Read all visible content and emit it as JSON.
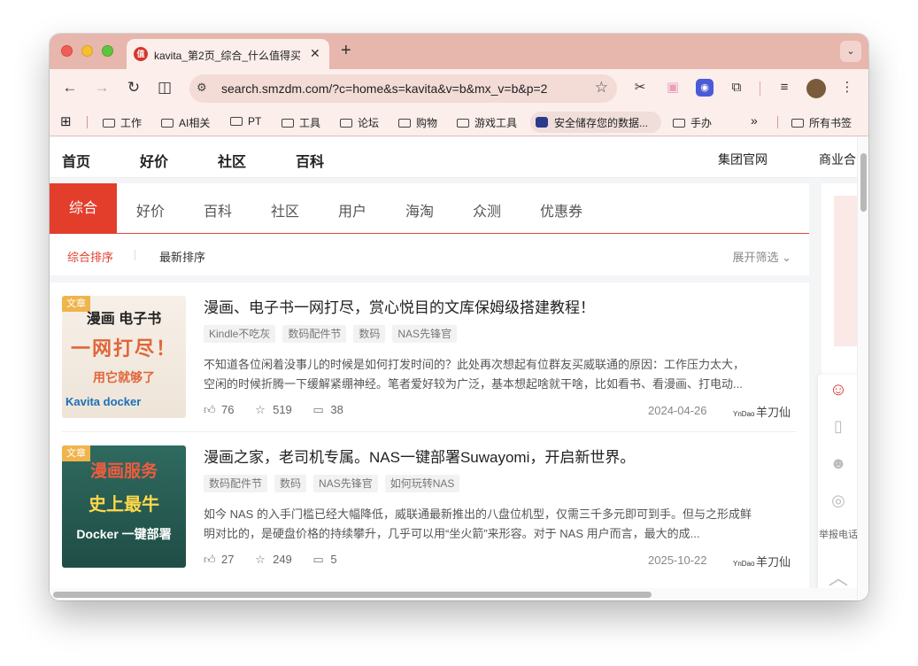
{
  "browser": {
    "tab_title": "kavita_第2页_综合_什么值得买",
    "tab_favicon": "值",
    "url": "search.smzdm.com/?c=home&s=kavita&v=b&mx_v=b&p=2",
    "bookmarks": [
      "工作",
      "AI相关",
      "PT",
      "工具",
      "论坛",
      "购物",
      "游戏工具"
    ],
    "bookmark_special": "安全储存您的数据...",
    "bookmark_after": "手办",
    "bookmark_more": "»",
    "bookmark_all": "所有书签"
  },
  "topnav": {
    "items": [
      "首页",
      "好价",
      "社区",
      "百科"
    ],
    "right": [
      "集团官网",
      "商业合"
    ]
  },
  "tabs": {
    "items": [
      "综合",
      "好价",
      "百科",
      "社区",
      "用户",
      "海淘",
      "众测",
      "优惠券"
    ]
  },
  "sort": {
    "items": [
      "综合排序",
      "最新排序"
    ],
    "filter": "展开筛选 ⌄"
  },
  "articles": [
    {
      "badge": "文章",
      "thumb_lines": [
        "漫画 电子书",
        "一网打尽！",
        "用它就够了",
        "Kavita  docker"
      ],
      "title": "漫画、电子书一网打尽，赏心悦目的文库保姆级搭建教程！",
      "tags": [
        "Kindle不吃灰",
        "数码配件节",
        "数码",
        "NAS先锋官"
      ],
      "desc1": "不知道各位闲着没事儿的时候是如何打发时间的？此处再次想起有位群友买威联通的原因：工作压力太大，",
      "desc2": "空闲的时候折腾一下缓解紧绷神经。笔者爱好较为广泛，基本想起啥就干啥，比如看书、看漫画、打电动...",
      "likes": "76",
      "favs": "519",
      "comments": "38",
      "date": "2024-04-26",
      "author": "羊刀仙",
      "author_mini": "YnDao"
    },
    {
      "badge": "文章",
      "thumb_lines": [
        "漫画服务",
        "史上最牛",
        "Docker 一键部署"
      ],
      "title": "漫画之家，老司机专属。NAS一键部署Suwayomi，开启新世界。",
      "tags": [
        "数码配件节",
        "数码",
        "NAS先锋官",
        "如何玩转NAS"
      ],
      "desc1": "如今 NAS 的入手门槛已经大幅降低，威联通最新推出的八盘位机型，仅需三千多元即可到手。但与之形成鲜",
      "desc2": "明对比的，是硬盘价格的持续攀升，几乎可以用“坐火箭”来形容。对于 NAS 用户而言，最大的成...",
      "likes": "27",
      "favs": "249",
      "comments": "5",
      "date": "2025-10-22",
      "author": "羊刀仙",
      "author_mini": "YnDao"
    }
  ],
  "float_bar": {
    "report": "举报电话"
  },
  "colors": {
    "accent": "#e33e2c",
    "tabstrip": "#e7b6ad",
    "toolbar": "#fbeeeb"
  }
}
